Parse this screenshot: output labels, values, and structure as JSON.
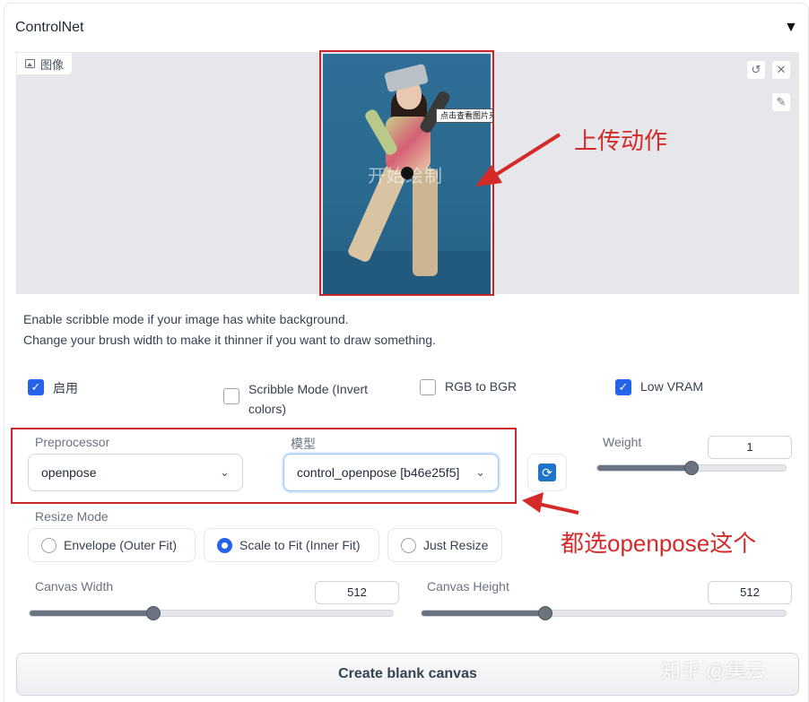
{
  "panel": {
    "title": "ControlNet"
  },
  "image_tab": {
    "label": "图像",
    "draw_hint": "开始绘制",
    "tooltip": "点击查看图片来源"
  },
  "annotations": {
    "upload": "上传动作",
    "select_openpose": "都选openpose这个"
  },
  "hint": {
    "line1": "Enable scribble mode if your image has white background.",
    "line2": "Change your brush width to make it thinner if you want to draw something."
  },
  "checkboxes": {
    "enable": {
      "label": "启用",
      "checked": true
    },
    "scribble": {
      "label_line1": "Scribble Mode (Invert",
      "label_line2": "colors)",
      "checked": false
    },
    "rgb_bgr": {
      "label": "RGB to BGR",
      "checked": false
    },
    "low_vram": {
      "label": "Low VRAM",
      "checked": true
    }
  },
  "preprocessor": {
    "label": "Preprocessor",
    "value": "openpose"
  },
  "model": {
    "label": "模型",
    "value": "control_openpose [b46e25f5]"
  },
  "weight": {
    "label": "Weight",
    "value": "1",
    "fraction": 0.5
  },
  "resize_mode": {
    "label": "Resize Mode",
    "options": [
      "Envelope (Outer Fit)",
      "Scale to Fit (Inner Fit)",
      "Just Resize"
    ],
    "selected": "Scale to Fit (Inner Fit)"
  },
  "canvas_width": {
    "label": "Canvas Width",
    "value": "512",
    "fraction": 0.34
  },
  "canvas_height": {
    "label": "Canvas Height",
    "value": "512",
    "fraction": 0.34
  },
  "create_button": {
    "label": "Create blank canvas"
  },
  "watermark": "知乎 @集云",
  "colors": {
    "accent": "#2563eb",
    "annotation": "#d42a2a"
  }
}
